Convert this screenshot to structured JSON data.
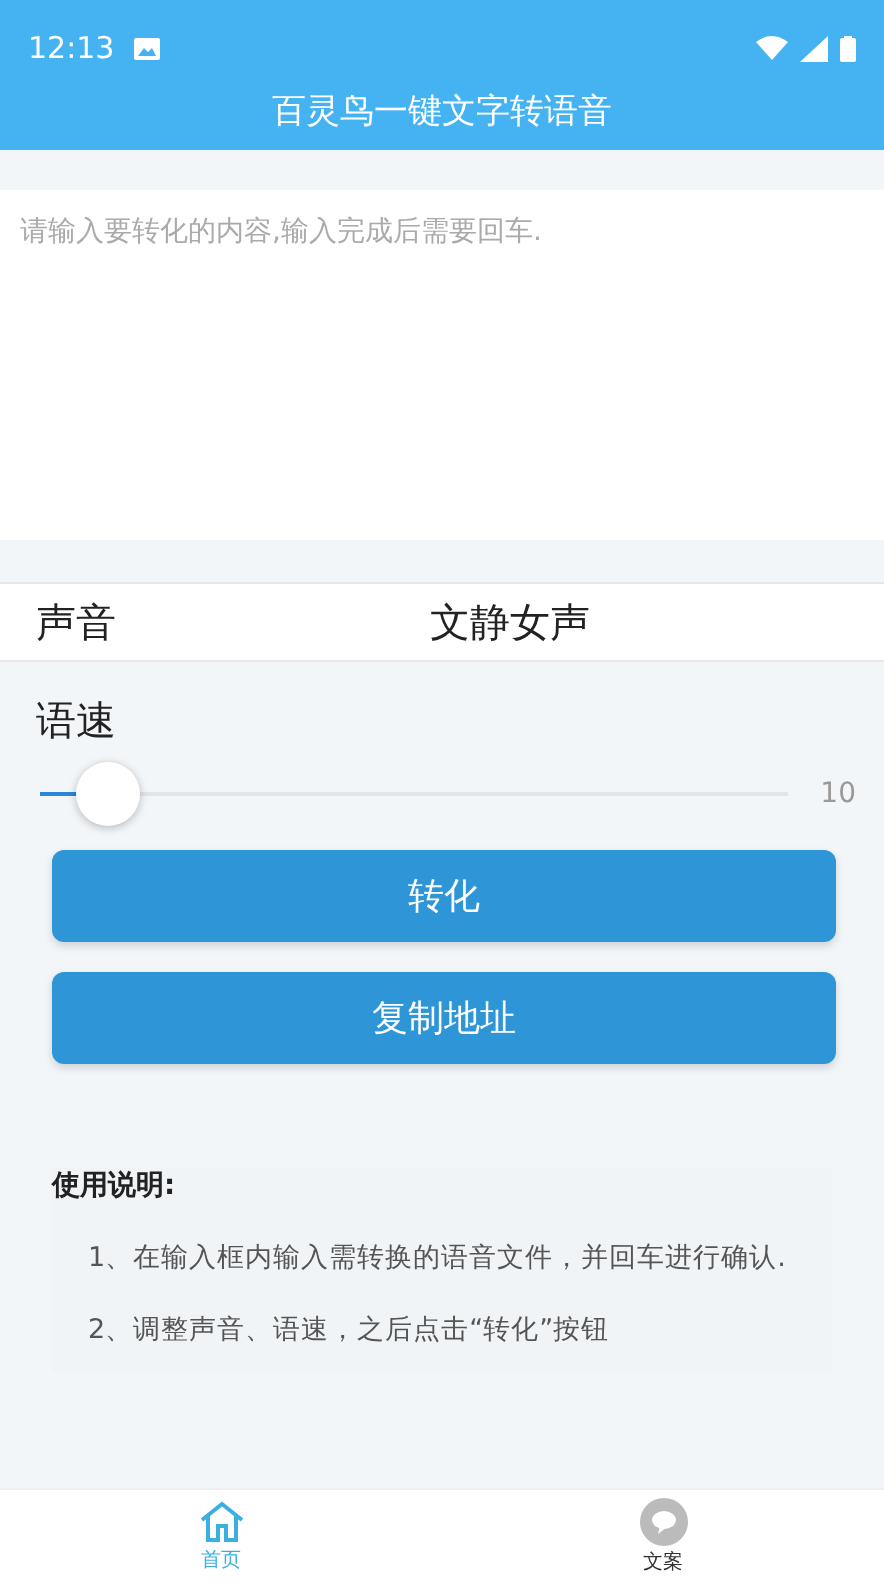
{
  "status_bar": {
    "time": "12:13"
  },
  "header": {
    "title": "百灵鸟一键文字转语音"
  },
  "input": {
    "placeholder": "请输入要转化的内容,输入完成后需要回车."
  },
  "voice": {
    "label": "声音",
    "value": "文静女声"
  },
  "speed": {
    "label": "语速",
    "level": 0.09,
    "reading": "10"
  },
  "buttons": [
    "转化",
    "复制地址"
  ],
  "instructions": {
    "title": "使用说明:",
    "items": [
      "1、在输入框内输入需转换的语音文件，并回车进行确认.",
      "2、调整声音、语速，之后点击“转化”按钮"
    ]
  },
  "nav": [
    {
      "label": "首页",
      "kind": "home",
      "selected": true
    },
    {
      "label": "文案",
      "kind": "bubble",
      "selected": false
    }
  ]
}
